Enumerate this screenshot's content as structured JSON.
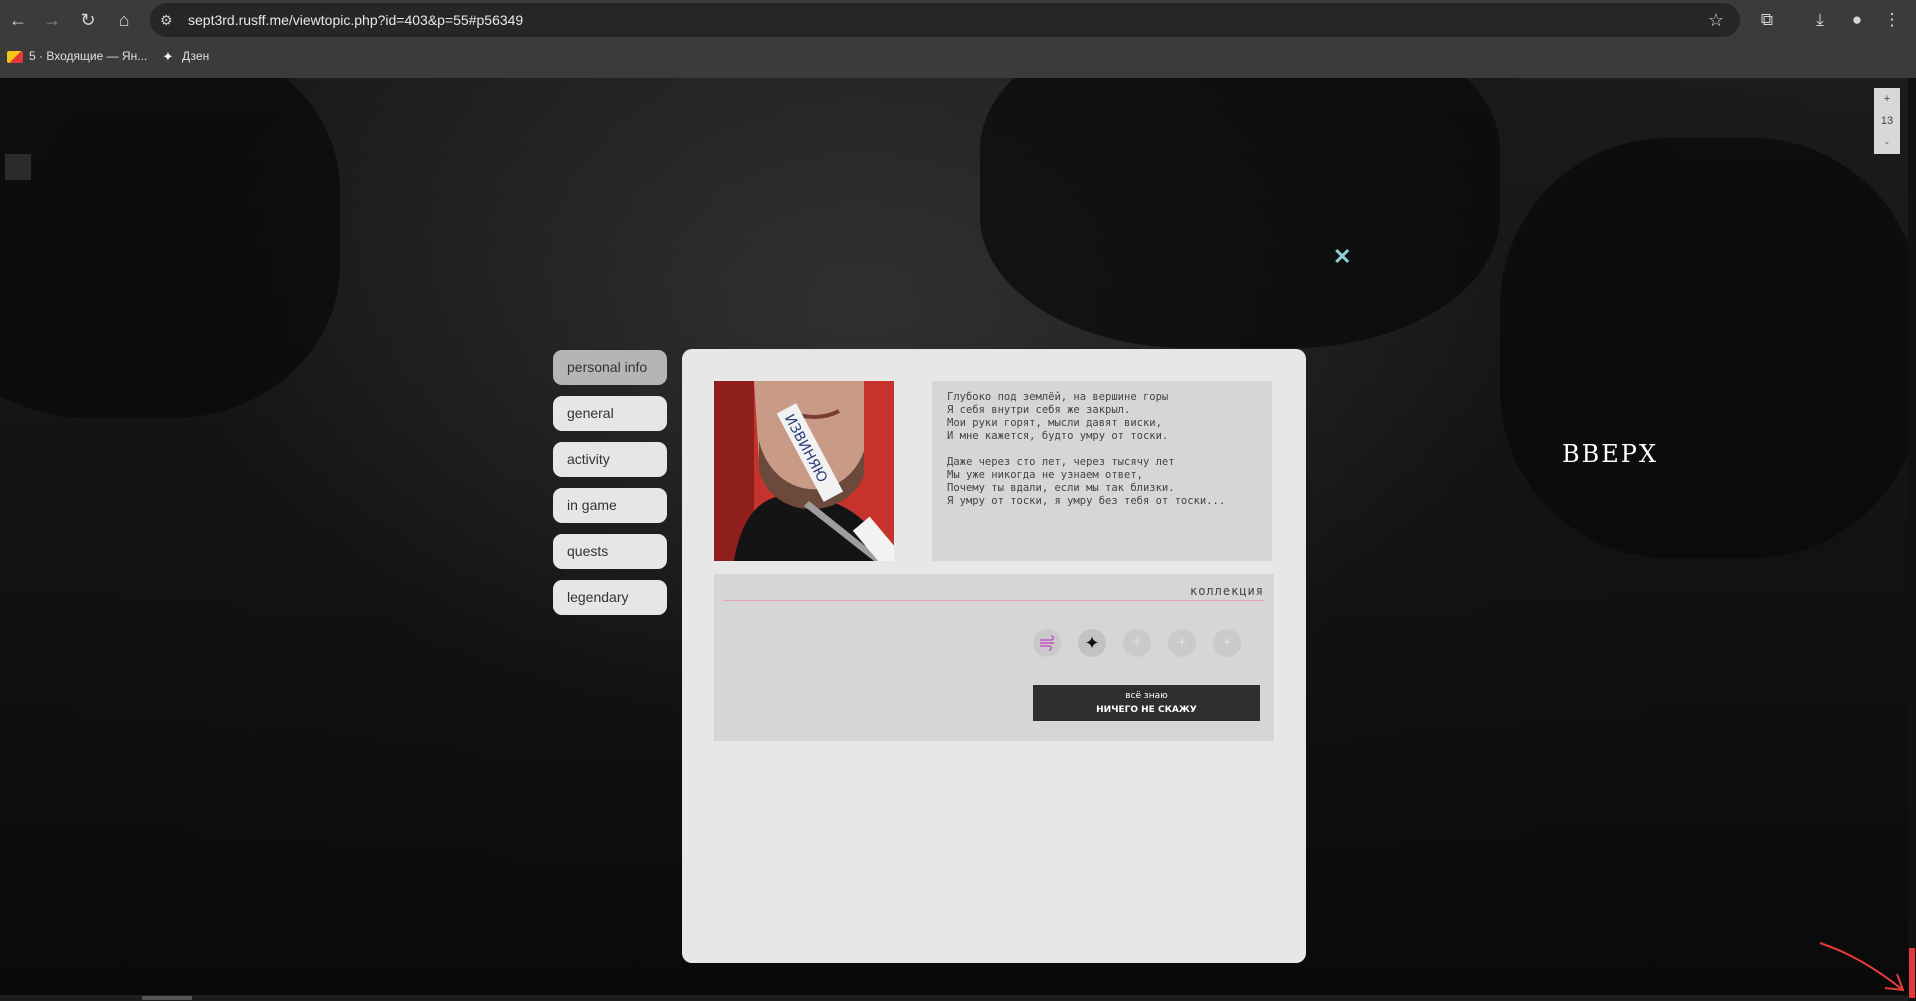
{
  "browser": {
    "url": "sept3rd.rusff.me/viewtopic.php?id=403&p=55#p56349",
    "bookmarks": [
      {
        "label": "5 · Входящие — Ян...",
        "icon": "mail-icon"
      },
      {
        "label": "Дзен",
        "icon": "dzen-icon"
      }
    ],
    "nav_icons": [
      "back-icon",
      "forward-icon",
      "reload-icon",
      "home-icon"
    ],
    "right_icons": [
      "extensions-icon",
      "download-icon",
      "profile-icon",
      "menu-icon"
    ]
  },
  "page": {
    "zoom": {
      "plus": "+",
      "value": "13",
      "minus": "-"
    },
    "up_label": "ВВЕРХ",
    "accent": "#e23a3a"
  },
  "modal": {
    "close": "✕",
    "tabs": [
      {
        "label": "personal info",
        "active": true
      },
      {
        "label": "general"
      },
      {
        "label": "activity"
      },
      {
        "label": "in game"
      },
      {
        "label": "quests"
      },
      {
        "label": "legendary"
      }
    ],
    "photo_caption": "ИЗВИНЯЮ",
    "poem": [
      "Глубоко под землёй, на вершине горы",
      "Я себя внутри себя же закрыл.",
      "Мои руки горят, мысли давят виски,",
      "И мне кажется, будто умру от тоски.",
      "Даже через сто лет, через тысячу лет",
      "Мы уже никогда не узнаем ответ,",
      "Почему ты вдали, если мы так близки.",
      "Я умру от тоски, я умру без тебя от тоски..."
    ],
    "collection": {
      "title": "коллекция",
      "badges": [
        "wind-icon",
        "sparkle-icon",
        "plus-icon",
        "plus-icon",
        "plus-icon"
      ],
      "button_line1": "всё знаю",
      "button_line2": "ничего не скажу"
    }
  }
}
